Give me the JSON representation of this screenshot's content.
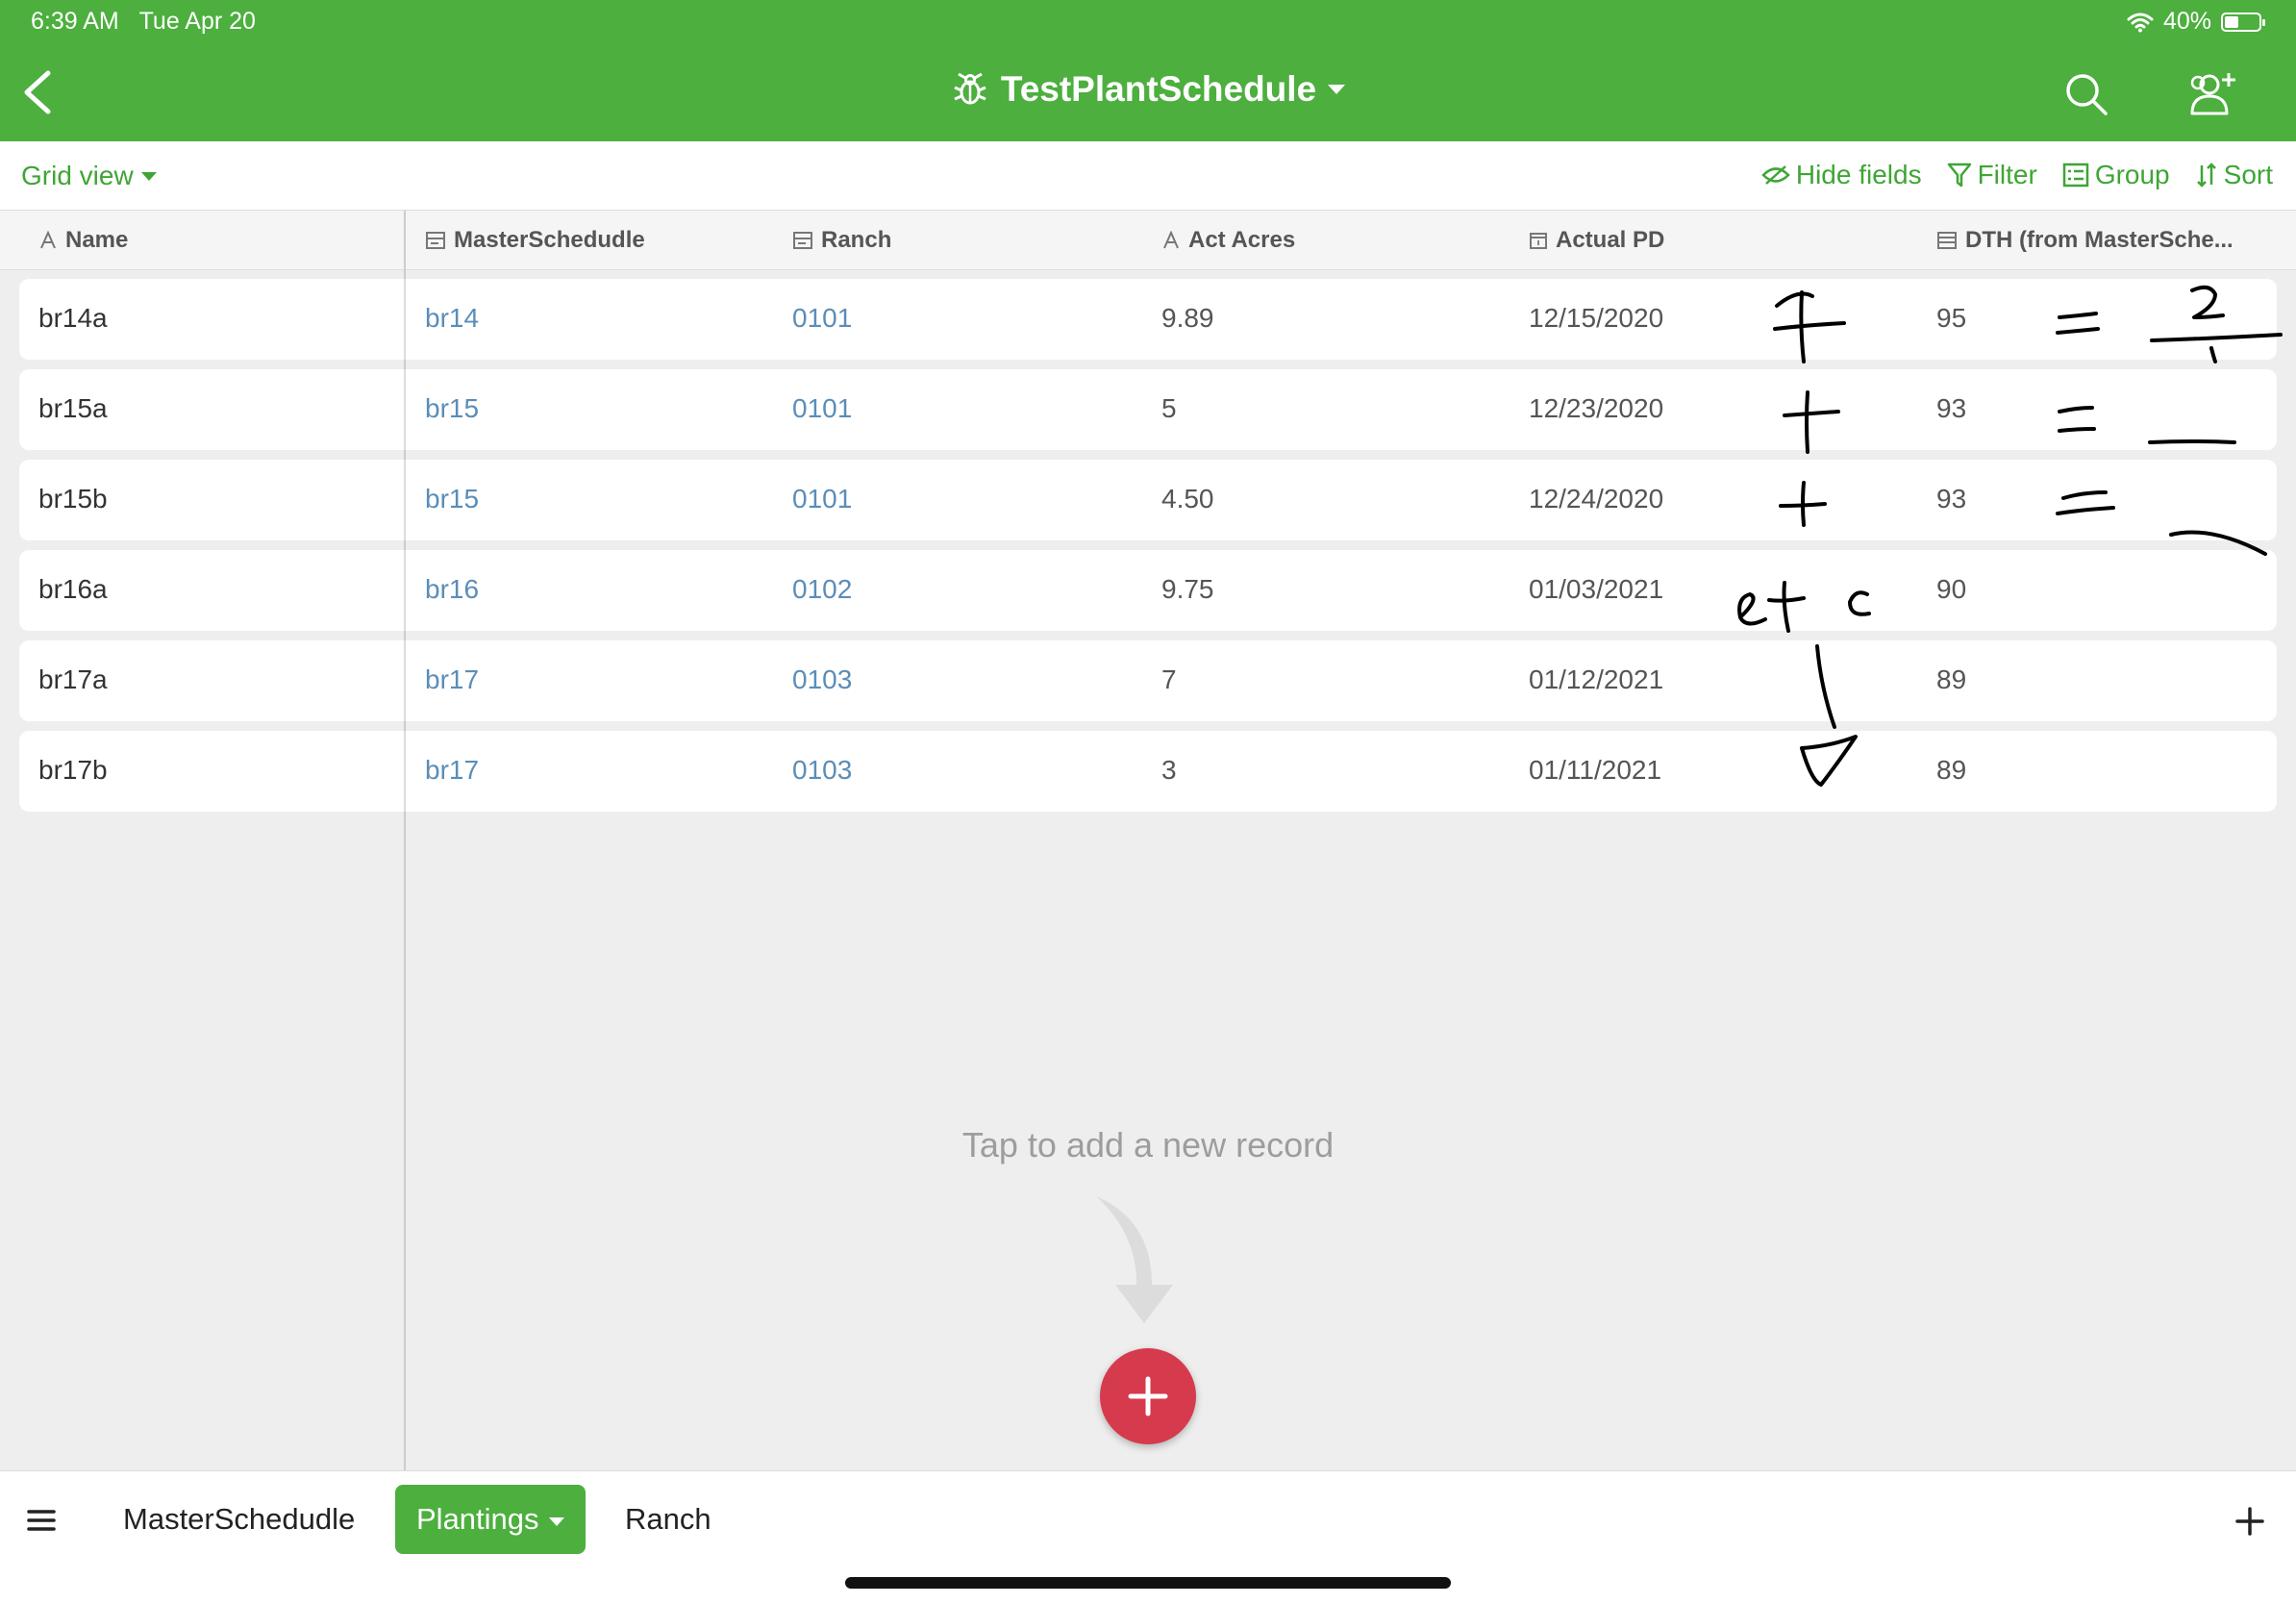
{
  "status_bar": {
    "time": "6:39 AM",
    "date": "Tue Apr 20",
    "battery": "40%",
    "battery_level": 0.4
  },
  "header": {
    "title": "TestPlantSchedule"
  },
  "toolbar": {
    "view_label": "Grid view",
    "hide_fields": "Hide fields",
    "filter": "Filter",
    "group": "Group",
    "sort": "Sort"
  },
  "columns": [
    "Name",
    "MasterSchedudle",
    "Ranch",
    "Act Acres",
    "Actual PD",
    "DTH (from MasterSche..."
  ],
  "rows": [
    {
      "name": "br14a",
      "master": "br14",
      "ranch": "0101",
      "acres": "9.89",
      "pd": "12/15/2020",
      "dth": "95"
    },
    {
      "name": "br15a",
      "master": "br15",
      "ranch": "0101",
      "acres": "5",
      "pd": "12/23/2020",
      "dth": "93"
    },
    {
      "name": "br15b",
      "master": "br15",
      "ranch": "0101",
      "acres": "4.50",
      "pd": "12/24/2020",
      "dth": "93"
    },
    {
      "name": "br16a",
      "master": "br16",
      "ranch": "0102",
      "acres": "9.75",
      "pd": "01/03/2021",
      "dth": "90"
    },
    {
      "name": "br17a",
      "master": "br17",
      "ranch": "0103",
      "acres": "7",
      "pd": "01/12/2021",
      "dth": "89"
    },
    {
      "name": "br17b",
      "master": "br17",
      "ranch": "0103",
      "acres": "3",
      "pd": "01/11/2021",
      "dth": "89"
    }
  ],
  "annotations": {
    "etc": "etc"
  },
  "empty_state": {
    "hint": "Tap to add a new record"
  },
  "tabs": {
    "t1": "MasterSchedudle",
    "t2": "Plantings",
    "t3": "Ranch"
  },
  "colors": {
    "brand_green": "#4caf3e",
    "link_blue": "#5b8db8",
    "fab_red": "#d63a4d"
  }
}
